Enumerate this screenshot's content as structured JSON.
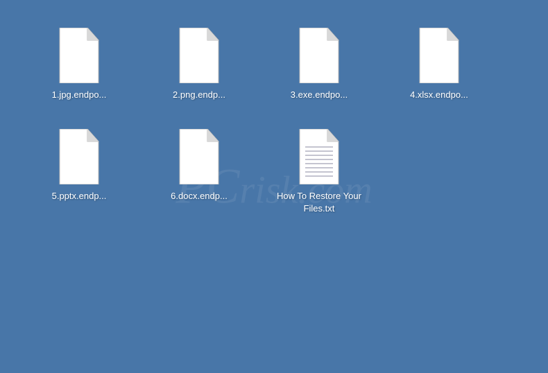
{
  "files": [
    {
      "label": "1.jpg.endpo...",
      "type": "blank"
    },
    {
      "label": "2.png.endp...",
      "type": "blank"
    },
    {
      "label": "3.exe.endpo...",
      "type": "blank"
    },
    {
      "label": "4.xlsx.endpo...",
      "type": "blank"
    },
    {
      "label": "5.pptx.endp...",
      "type": "blank"
    },
    {
      "label": "6.docx.endp...",
      "type": "blank"
    },
    {
      "label": "How To Restore Your Files.txt",
      "type": "text"
    }
  ],
  "watermark": "PCrisk.com"
}
